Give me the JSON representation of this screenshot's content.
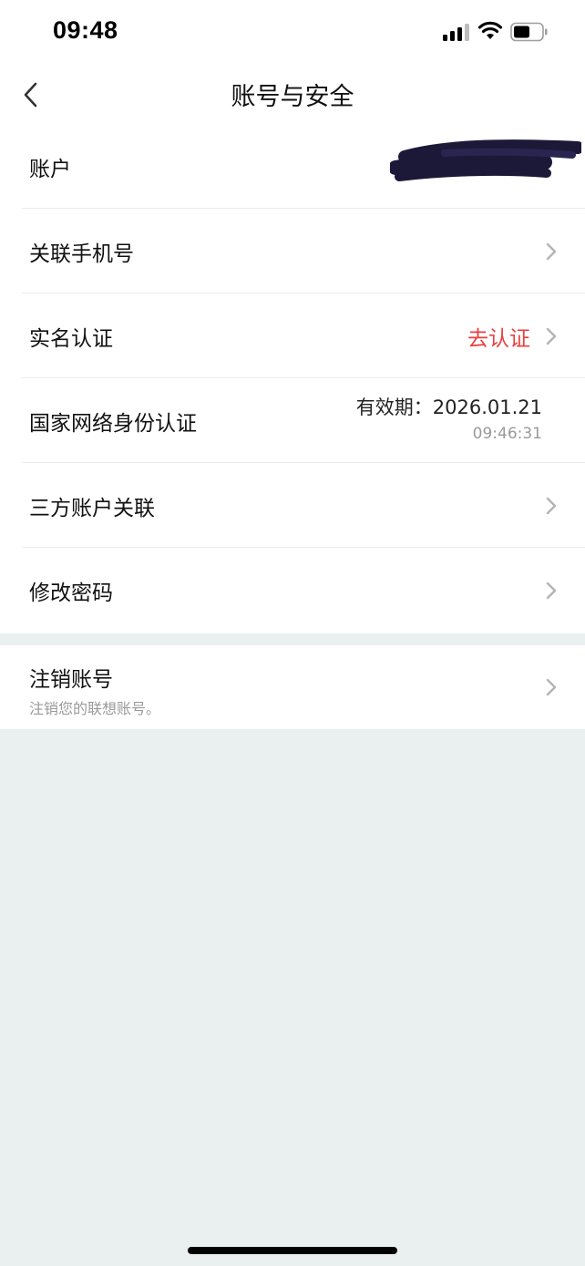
{
  "status_bar": {
    "time": "09:48"
  },
  "nav": {
    "title": "账号与安全",
    "back_icon": "chevron-left-icon"
  },
  "rows": {
    "account": {
      "label": "账户"
    },
    "phone": {
      "label": "关联手机号"
    },
    "realname": {
      "label": "实名认证",
      "action": "去认证"
    },
    "national_id": {
      "label": "国家网络身份认证",
      "validity": "有效期：2026.01.21",
      "validity_time": "09:46:31"
    },
    "third_party": {
      "label": "三方账户关联"
    },
    "password": {
      "label": "修改密码"
    }
  },
  "cancel_account": {
    "title": "注销账号",
    "subtitle": "注销您的联想账号。"
  },
  "colors": {
    "accent_red": "#e8403f",
    "background": "#eaf0ef",
    "card": "#ffffff",
    "secondary_text": "#9a9a9a"
  }
}
